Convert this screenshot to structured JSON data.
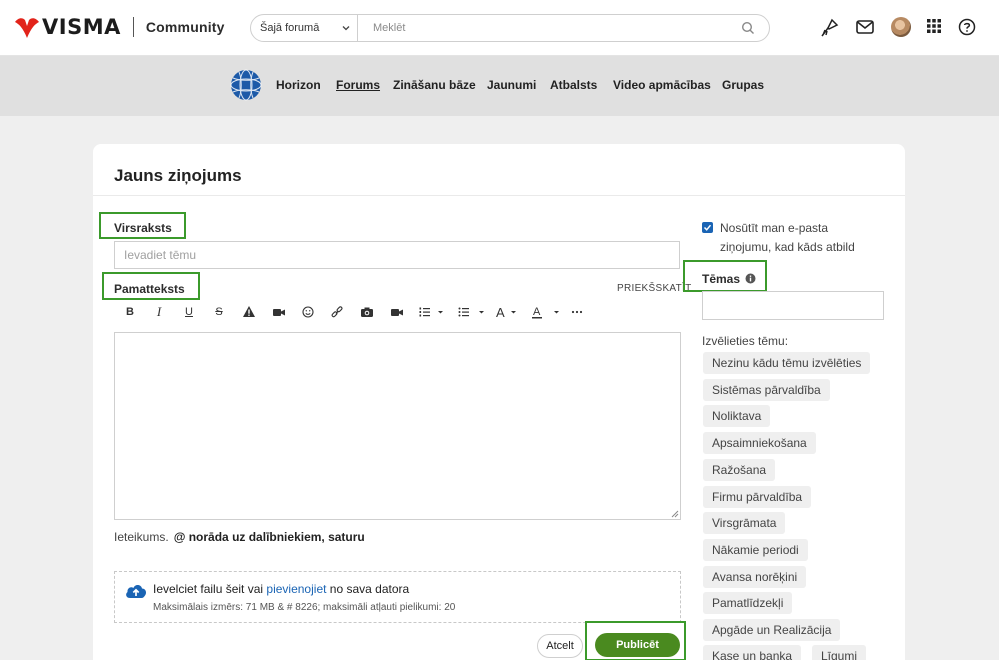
{
  "header": {
    "brand": "VISMA",
    "community": "Community",
    "search_scope": "Šajā forumā",
    "search_placeholder": "Meklēt"
  },
  "nav": {
    "items": [
      "Horizon",
      "Forums",
      "Zināšanu bāze",
      "Jaunumi",
      "Atbalsts",
      "Video apmācības",
      "Grupas"
    ],
    "active": "Forums"
  },
  "form": {
    "title": "Jauns ziņojums",
    "subject_label": "Virsraksts",
    "subject_placeholder": "Ievadiet tēmu",
    "body_label": "Pamatteksts",
    "preview": "PRIEKŠSKATĪT",
    "hint_label": "Ieteikums.",
    "hint_text": "@ norāda uz dalībniekiem, saturu",
    "upload_text_before": "Ievelciet failu šeit vai",
    "upload_link": "pievienojiet",
    "upload_text_after": "no sava datora",
    "upload_limits": "Maksimālais izmērs: 71 MB & # 8226; maksimāli atļauti pielikumi: 20",
    "cancel": "Atcelt",
    "publish": "Publicēt"
  },
  "sidebar": {
    "notify_checked": true,
    "notify_text": "Nosūtīt man e-pasta ziņojumu, kad kāds atbild",
    "tags_label": "Tēmas",
    "choose_label": "Izvēlieties tēmu:",
    "tags": [
      "Nezinu kādu tēmu izvēlēties",
      "Sistēmas pārvaldība",
      "Noliktava",
      "Apsaimniekošana",
      "Ražošana",
      "Firmu pārvaldība",
      "Virsgrāmata",
      "Nākamie periodi",
      "Avansa norēķini",
      "Pamatlīdzekļi",
      "Apgāde un Realizācija",
      "Kase un banka",
      "Līgumi"
    ]
  },
  "colors": {
    "brand_red": "#e2231a",
    "highlight_green": "#3b9a2b",
    "publish_green": "#4a8a1f",
    "link_blue": "#1a64b4"
  }
}
